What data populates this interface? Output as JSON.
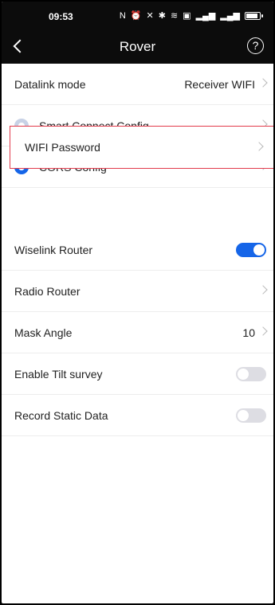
{
  "statusbar": {
    "time": "09:53",
    "icons": [
      "nfc-icon",
      "alarm-icon",
      "mute-icon",
      "bluetooth-icon",
      "wifi-icon",
      "hd-icon",
      "signal-icon",
      "signal-icon",
      "battery-icon"
    ]
  },
  "header": {
    "title": "Rover"
  },
  "settings": {
    "datalink_mode": {
      "label": "Datalink mode",
      "value": "Receiver WIFI"
    },
    "smart_connect": {
      "label": "Smart Connect Config",
      "selected": false
    },
    "cors_config": {
      "label": "CORS Config",
      "selected": true
    },
    "wifi_password": {
      "label": "WIFI Password"
    },
    "wiselink_router": {
      "label": "Wiselink Router",
      "enabled": true
    },
    "radio_router": {
      "label": "Radio Router"
    },
    "mask_angle": {
      "label": "Mask Angle",
      "value": "10"
    },
    "enable_tilt_survey": {
      "label": "Enable Tilt survey",
      "enabled": false
    },
    "record_static_data": {
      "label": "Record Static Data",
      "enabled": false
    }
  },
  "colors": {
    "accent": "#1565e8",
    "highlight_border": "#e23a4b",
    "topbar_bg": "#0c0c0c"
  }
}
